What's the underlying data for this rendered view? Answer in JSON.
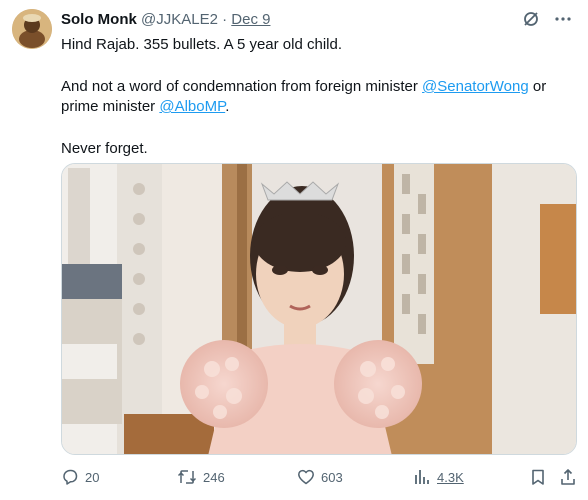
{
  "tweet": {
    "author_name": "Solo Monk",
    "author_handle": "@JJKALE2",
    "separator": "·",
    "date": "Dec 9",
    "line1": "Hind Rajab. 355 bullets. A 5 year old child.",
    "line2_prefix": "And not a word of condemnation from foreign minister ",
    "mention1": "@SenatorWong",
    "line2_mid": " or prime minister ",
    "mention2": "@AlboMP",
    "line2_suffix": ".",
    "line3": "Never forget."
  },
  "actions": {
    "replies": "20",
    "reposts": "246",
    "likes": "603",
    "views": "4.3K"
  },
  "icons": {
    "grok": "slashed-circle-icon",
    "more": "more-icon",
    "reply": "reply-icon",
    "repost": "repost-icon",
    "like": "heart-icon",
    "views": "views-icon",
    "bookmark": "bookmark-icon",
    "share": "share-icon"
  },
  "colors": {
    "link": "#1d9bf0",
    "muted": "#536471",
    "text": "#0f1419"
  }
}
